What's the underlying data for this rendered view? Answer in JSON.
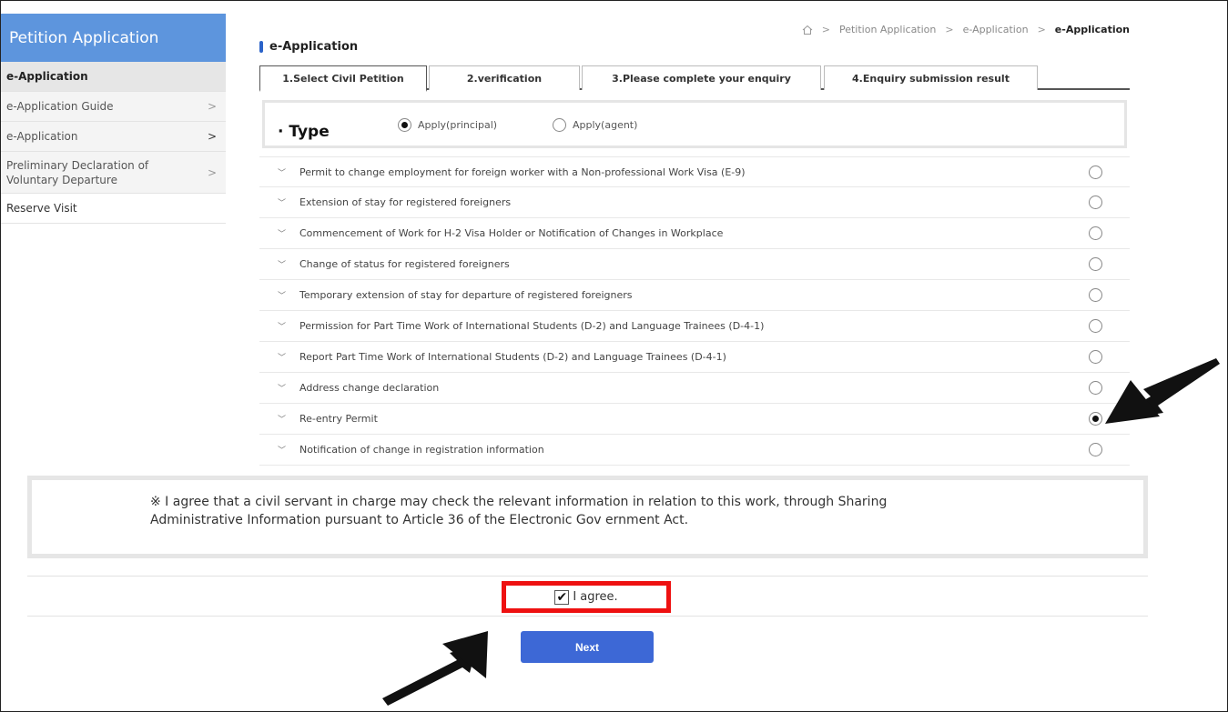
{
  "sidebar": {
    "title": "Petition Application",
    "items": [
      {
        "label": "e-Application",
        "chevron": ""
      },
      {
        "label": "e-Application Guide",
        "chevron": ">"
      },
      {
        "label": "e-Application",
        "chevron": ">"
      },
      {
        "label_line1": "Preliminary Declaration of",
        "label_line2": "Voluntary Departure",
        "chevron": ">"
      },
      {
        "label": "Reserve Visit",
        "chevron": ""
      }
    ]
  },
  "breadcrumb": {
    "home_icon": "home-icon",
    "separator": ">",
    "items": [
      "Petition Application",
      "e-Application",
      "e-Application"
    ]
  },
  "page_title": "e-Application",
  "tabs": [
    {
      "label": "1.Select Civil Petition",
      "active": true
    },
    {
      "label": "2.verification",
      "active": false
    },
    {
      "label": "3.Please complete your enquiry",
      "active": false
    },
    {
      "label": "4.Enquiry submission result",
      "active": false
    }
  ],
  "type_section": {
    "label": "· Type",
    "options": [
      {
        "label": "Apply(principal)",
        "selected": true
      },
      {
        "label": "Apply(agent)",
        "selected": false
      }
    ]
  },
  "petitions": [
    {
      "label": "Permit to change employment for foreign worker with a Non-professional Work Visa (E-9)",
      "selected": false
    },
    {
      "label": "Extension of stay for registered foreigners",
      "selected": false
    },
    {
      "label": "Commencement of Work for H-2 Visa Holder or Notification of Changes in Workplace",
      "selected": false
    },
    {
      "label": "Change of status for registered foreigners",
      "selected": false
    },
    {
      "label": "Temporary extension of stay for departure of registered foreigners",
      "selected": false
    },
    {
      "label": "Permission for Part Time Work of International Students (D-2) and Language Trainees (D-4-1)",
      "selected": false
    },
    {
      "label": "Report Part Time Work of International Students (D-2) and Language Trainees (D-4-1)",
      "selected": false
    },
    {
      "label": "Address change declaration",
      "selected": false
    },
    {
      "label": "Re-entry Permit",
      "selected": true
    },
    {
      "label": "Notification of change in registration information",
      "selected": false
    }
  ],
  "consent": {
    "text": "※ I agree that a civil servant in charge may check the relevant information in relation to this work, through Sharing Administrative Information pursuant to Article 36 of the Electronic Gov ernment Act."
  },
  "agree": {
    "label": "I agree.",
    "checked": true
  },
  "next_button": "Next",
  "colors": {
    "sidebar_header": "#5d95dd",
    "next_button": "#3d68d6",
    "highlight": "#ee1111"
  }
}
